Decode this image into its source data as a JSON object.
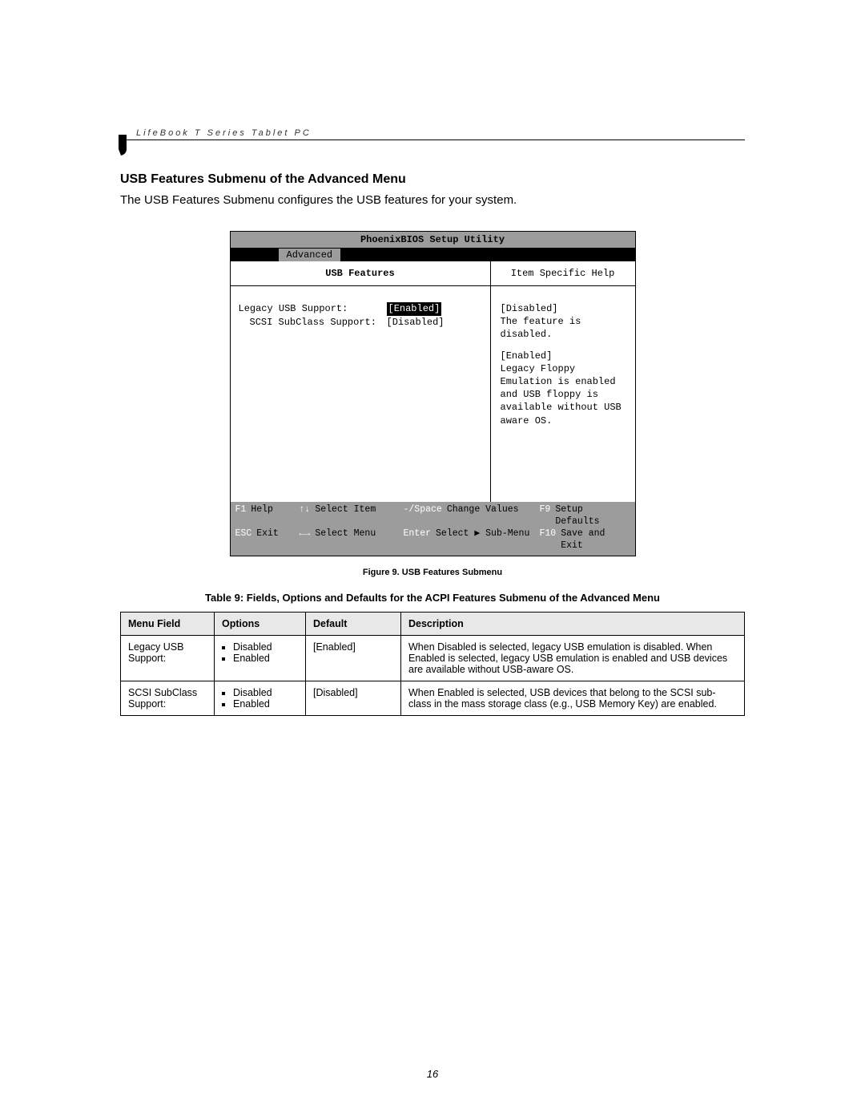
{
  "header": {
    "product": "LifeBook T Series Tablet PC"
  },
  "section": {
    "title": "USB Features Submenu of the Advanced Menu",
    "intro": "The USB Features Submenu configures the USB features for your system."
  },
  "bios": {
    "title": "PhoenixBIOS Setup Utility",
    "tab": "Advanced",
    "panel_title": "USB Features",
    "help_title": "Item Specific Help",
    "options": [
      {
        "label": "Legacy USB Support:",
        "value": "[Enabled]",
        "selected": true
      },
      {
        "label": "SCSI SubClass Support:",
        "value": "[Disabled]",
        "selected": false
      }
    ],
    "help": {
      "disabled_label": "[Disabled]",
      "disabled_text": "The feature is disabled.",
      "enabled_label": "[Enabled]",
      "enabled_text": "Legacy Floppy Emulation is enabled and USB floppy is available without USB aware OS."
    },
    "footer": {
      "row1": [
        {
          "key": "F1",
          "action": "Help"
        },
        {
          "key": "↑↓",
          "action": "Select Item"
        },
        {
          "key": "-/Space",
          "action": "Change Values"
        },
        {
          "key": "F9",
          "action": "Setup Defaults"
        }
      ],
      "row2": [
        {
          "key": "ESC",
          "action": "Exit"
        },
        {
          "key": "←→",
          "action": "Select Menu"
        },
        {
          "key": "Enter",
          "action": "Select ▶ Sub-Menu"
        },
        {
          "key": "F10",
          "action": "Save and Exit"
        }
      ]
    }
  },
  "figure_caption": "Figure 9.  USB Features Submenu",
  "table_caption": "Table 9: Fields, Options and Defaults for the ACPI Features Submenu of the Advanced Menu",
  "table": {
    "headers": [
      "Menu Field",
      "Options",
      "Default",
      "Description"
    ],
    "rows": [
      {
        "field": "Legacy USB Support:",
        "options": [
          "Disabled",
          "Enabled"
        ],
        "default": "[Enabled]",
        "description": "When Disabled is selected, legacy USB emulation is disabled. When Enabled is selected, legacy USB emulation is enabled and USB devices are available without USB-aware OS."
      },
      {
        "field": "SCSI SubClass Support:",
        "options": [
          "Disabled",
          "Enabled"
        ],
        "default": "[Disabled]",
        "description": "When Enabled is selected, USB devices that belong to the SCSI sub-class in the mass storage class (e.g., USB Memory Key) are enabled."
      }
    ]
  },
  "page_number": "16"
}
